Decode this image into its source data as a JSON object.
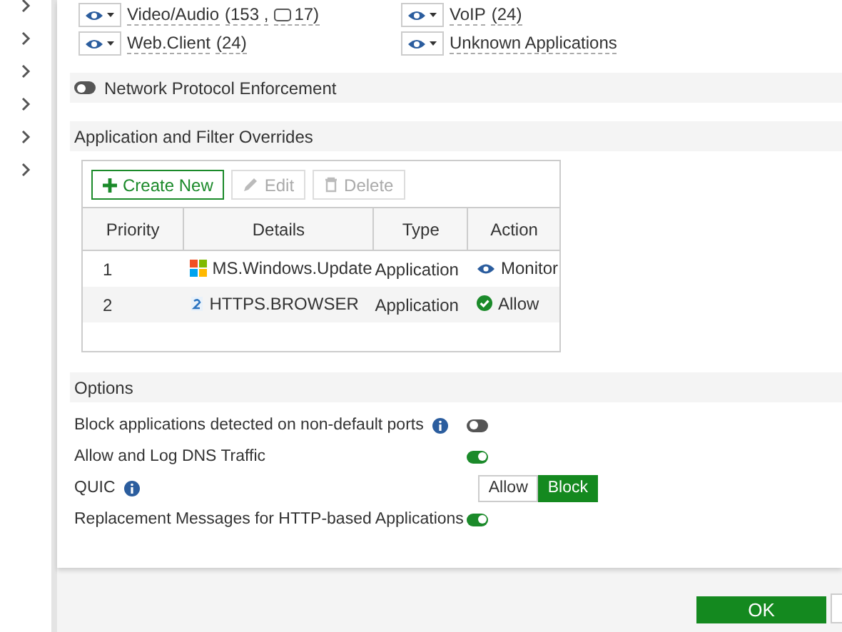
{
  "sidebar": {
    "items": [
      {
        "expanded": false
      },
      {
        "expanded": false
      },
      {
        "expanded": false
      },
      {
        "expanded": false
      },
      {
        "expanded": false
      },
      {
        "expanded": false
      }
    ]
  },
  "categories": [
    {
      "name": "Video/Audio",
      "count": "(153 ,",
      "extra": "17)"
    },
    {
      "name": "VoIP",
      "count": "(24)"
    },
    {
      "name": "Web.Client",
      "count": "(24)"
    },
    {
      "name": "Unknown Applications"
    }
  ],
  "network_protocol_enforcement": {
    "label": "Network Protocol Enforcement",
    "on": false
  },
  "overrides": {
    "title": "Application and Filter Overrides",
    "toolbar": [
      {
        "label": "Create New",
        "kind": "create",
        "disabled": false
      },
      {
        "label": "Edit",
        "kind": "edit",
        "disabled": true
      },
      {
        "label": "Delete",
        "kind": "delete",
        "disabled": true
      }
    ],
    "columns": [
      "Priority",
      "Details",
      "Type",
      "Action"
    ],
    "rows": [
      {
        "priority": "1",
        "details": "MS.Windows.Update",
        "kind": "windows",
        "type": "Application",
        "action": {
          "label": "Monitor",
          "kind": "monitor"
        }
      },
      {
        "priority": "2",
        "details": "HTTPS.BROWSER",
        "kind": "web",
        "type": "Application",
        "action": {
          "label": "Allow",
          "kind": "allow"
        }
      }
    ]
  },
  "options": {
    "title": "Options",
    "items": [
      {
        "label": "Block applications detected on non-default ports",
        "info": true,
        "kind": "toggle",
        "on": false
      },
      {
        "label": "Allow and Log DNS Traffic",
        "info": false,
        "kind": "toggle",
        "on": true
      },
      {
        "label": "QUIC",
        "info": true,
        "kind": "segmented",
        "choices": [
          {
            "label": "Allow",
            "selected": false
          },
          {
            "label": "Block",
            "selected": true
          }
        ]
      },
      {
        "label": "Replacement Messages for HTTP-based Applications",
        "info": false,
        "kind": "toggle",
        "on": true
      }
    ]
  },
  "footer": {
    "buttons": [
      "OK"
    ]
  }
}
